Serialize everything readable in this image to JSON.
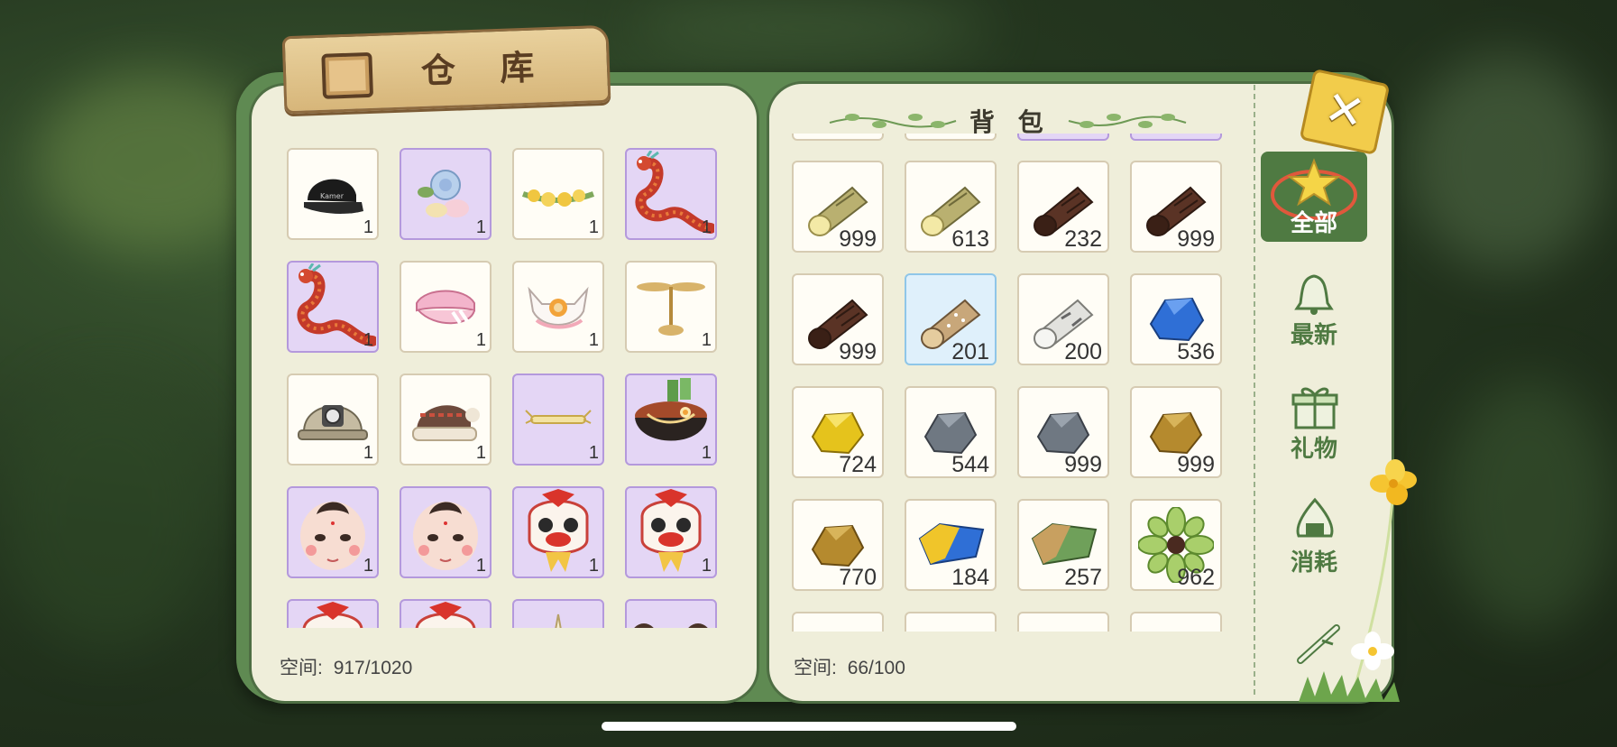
{
  "warehouse": {
    "title": "仓 库",
    "capacity_label": "空间:",
    "capacity_value": "917/1020",
    "items": [
      {
        "icon": "black-cap-icon",
        "count": "1",
        "rarity": "normal"
      },
      {
        "icon": "flower-hairpin-icon",
        "count": "1",
        "rarity": "purple"
      },
      {
        "icon": "flower-garland-icon",
        "count": "1",
        "rarity": "normal"
      },
      {
        "icon": "red-dragon-icon",
        "count": "1",
        "rarity": "purple"
      },
      {
        "icon": "red-dragon-icon",
        "count": "1",
        "rarity": "purple"
      },
      {
        "icon": "pink-visor-icon",
        "count": "1",
        "rarity": "normal"
      },
      {
        "icon": "cat-ear-cap-icon",
        "count": "1",
        "rarity": "normal"
      },
      {
        "icon": "propeller-icon",
        "count": "1",
        "rarity": "normal"
      },
      {
        "icon": "miner-helmet-icon",
        "count": "1",
        "rarity": "normal"
      },
      {
        "icon": "knit-hat-icon",
        "count": "1",
        "rarity": "normal"
      },
      {
        "icon": "halo-icon",
        "count": "1",
        "rarity": "purple"
      },
      {
        "icon": "noodle-bowl-icon",
        "count": "1",
        "rarity": "purple"
      },
      {
        "icon": "doll-face-icon",
        "count": "1",
        "rarity": "purple"
      },
      {
        "icon": "doll-face-icon",
        "count": "1",
        "rarity": "purple"
      },
      {
        "icon": "lion-dance-mask-icon",
        "count": "1",
        "rarity": "purple"
      },
      {
        "icon": "lion-dance-mask-icon",
        "count": "1",
        "rarity": "purple"
      },
      {
        "icon": "lion-dance-mask-icon",
        "count": "",
        "rarity": "purple"
      },
      {
        "icon": "lion-dance-mask-icon",
        "count": "",
        "rarity": "purple"
      },
      {
        "icon": "unicorn-horn-icon",
        "count": "",
        "rarity": "purple"
      },
      {
        "icon": "hair-buns-icon",
        "count": "",
        "rarity": "purple"
      }
    ]
  },
  "backpack": {
    "title": "背 包",
    "capacity_label": "空间:",
    "capacity_value": "66/100",
    "items": [
      {
        "icon": "light-log-icon",
        "count": "999"
      },
      {
        "icon": "light-log-icon",
        "count": "613"
      },
      {
        "icon": "dark-log-icon",
        "count": "232"
      },
      {
        "icon": "dark-log-icon",
        "count": "999"
      },
      {
        "icon": "dark-log-icon",
        "count": "999"
      },
      {
        "icon": "speckled-log-icon",
        "count": "201",
        "selected": true
      },
      {
        "icon": "birch-log-icon",
        "count": "200"
      },
      {
        "icon": "blue-ore-icon",
        "count": "536"
      },
      {
        "icon": "gold-ore-icon",
        "count": "724"
      },
      {
        "icon": "gray-stone-icon",
        "count": "544"
      },
      {
        "icon": "gray-stone-icon",
        "count": "999"
      },
      {
        "icon": "copper-ore-icon",
        "count": "999"
      },
      {
        "icon": "copper-ore-icon",
        "count": "770"
      },
      {
        "icon": "blue-gold-ingot-icon",
        "count": "184"
      },
      {
        "icon": "green-ingot-icon",
        "count": "257"
      },
      {
        "icon": "green-flower-icon",
        "count": "962"
      }
    ]
  },
  "tabs": [
    {
      "id": "all",
      "label": "全部",
      "icon": "star-icon",
      "active": true
    },
    {
      "id": "new",
      "label": "最新",
      "icon": "bell-icon",
      "active": false
    },
    {
      "id": "gift",
      "label": "礼物",
      "icon": "gift-icon",
      "active": false
    },
    {
      "id": "consume",
      "label": "消耗",
      "icon": "rice-ball-icon",
      "active": false
    },
    {
      "id": "material",
      "label": "",
      "icon": "branch-icon",
      "active": false
    }
  ],
  "close": {
    "icon": "close-icon"
  }
}
